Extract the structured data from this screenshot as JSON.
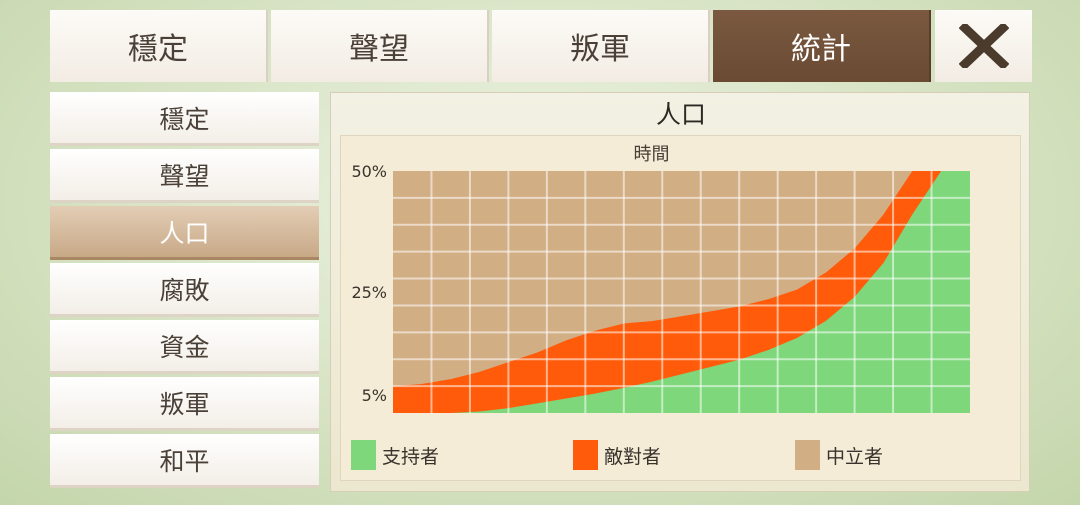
{
  "tabs": [
    {
      "label": "穩定",
      "active": false
    },
    {
      "label": "聲望",
      "active": false
    },
    {
      "label": "叛軍",
      "active": false
    },
    {
      "label": "統計",
      "active": true
    }
  ],
  "close_icon": "close-x-icon",
  "sidebar": {
    "items": [
      {
        "label": "穩定",
        "active": false
      },
      {
        "label": "聲望",
        "active": false
      },
      {
        "label": "人口",
        "active": true
      },
      {
        "label": "腐敗",
        "active": false
      },
      {
        "label": "資金",
        "active": false
      },
      {
        "label": "叛軍",
        "active": false
      },
      {
        "label": "和平",
        "active": false
      }
    ]
  },
  "panel": {
    "title": "人口"
  },
  "colors": {
    "supporters": "#7ed77a",
    "opposers": "#ff5b0a",
    "neutral": "#d2ae84",
    "tab_active": "#6d4c35",
    "sidebar_active": "#c8a987"
  },
  "chart_data": {
    "type": "area",
    "stacked": true,
    "xlabel": "時間",
    "ylabel": "",
    "ylim": [
      0,
      50
    ],
    "y_ticks": [
      {
        "value": 50,
        "label": "50%"
      },
      {
        "value": 25,
        "label": "25%"
      },
      {
        "value": 5,
        "label": "5%"
      }
    ],
    "grid": true,
    "legend_position": "bottom",
    "x": [
      0,
      2,
      4,
      6,
      8,
      10,
      12,
      14,
      16,
      18,
      20,
      22,
      24,
      26,
      28,
      30,
      32,
      34,
      36,
      38,
      40
    ],
    "series": [
      {
        "name": "支持者",
        "color": "#7ed77a",
        "values": [
          0,
          0,
          0,
          0.3,
          1,
          2,
          3,
          4,
          5.2,
          6.5,
          8,
          9.5,
          11,
          13,
          15.5,
          19,
          24,
          31,
          41,
          50,
          50
        ]
      },
      {
        "name": "敵對者",
        "color": "#ff5b0a",
        "values": [
          5.5,
          6,
          7,
          8.5,
          10.5,
          12.5,
          15,
          17,
          18.5,
          19,
          20,
          21,
          22,
          23.5,
          25.5,
          29,
          34,
          41,
          50,
          50,
          50
        ]
      },
      {
        "name": "中立者",
        "color": "#d2ae84",
        "values": [
          50,
          50,
          50,
          50,
          50,
          50,
          50,
          50,
          50,
          50,
          50,
          50,
          50,
          50,
          50,
          50,
          50,
          50,
          50,
          50,
          50
        ]
      }
    ]
  }
}
